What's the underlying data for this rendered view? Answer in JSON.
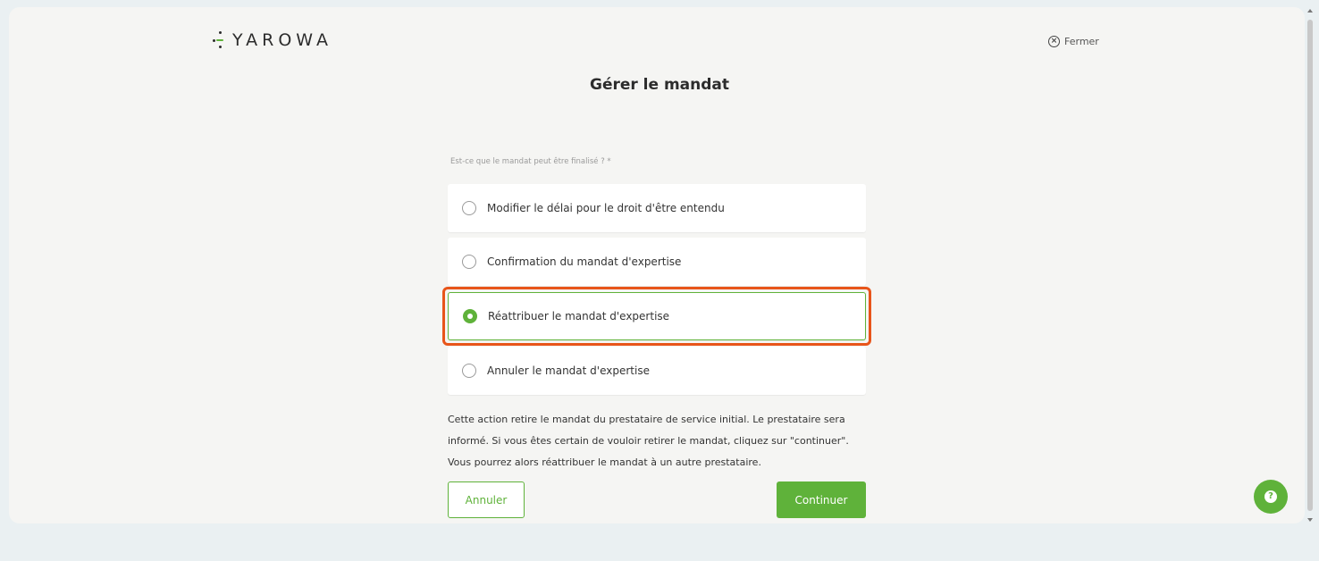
{
  "brand": {
    "name": "YAROWA"
  },
  "header": {
    "close_label": "Fermer",
    "title": "Gérer le mandat"
  },
  "form": {
    "question": "Est-ce que le mandat peut être finalisé ? *",
    "options": [
      {
        "label": "Modifier le délai pour le droit d'être entendu",
        "selected": false
      },
      {
        "label": "Confirmation du mandat d'expertise",
        "selected": false
      },
      {
        "label": "Réattribuer le mandat d'expertise",
        "selected": true
      },
      {
        "label": "Annuler le mandat d'expertise",
        "selected": false
      }
    ],
    "info_text": "Cette action retire le mandat du prestataire de service initial. Le prestataire sera informé. Si vous êtes certain de vouloir retirer le mandat, cliquez sur \"continuer\". Vous pourrez alors réattribuer le mandat à un autre prestataire."
  },
  "actions": {
    "cancel_label": "Annuler",
    "continue_label": "Continuer"
  },
  "help": {
    "icon_glyph": "?"
  },
  "colors": {
    "accent": "#5fb23a",
    "highlight": "#e8551a",
    "background": "#eaf0f2",
    "card": "#f5f5f3"
  }
}
